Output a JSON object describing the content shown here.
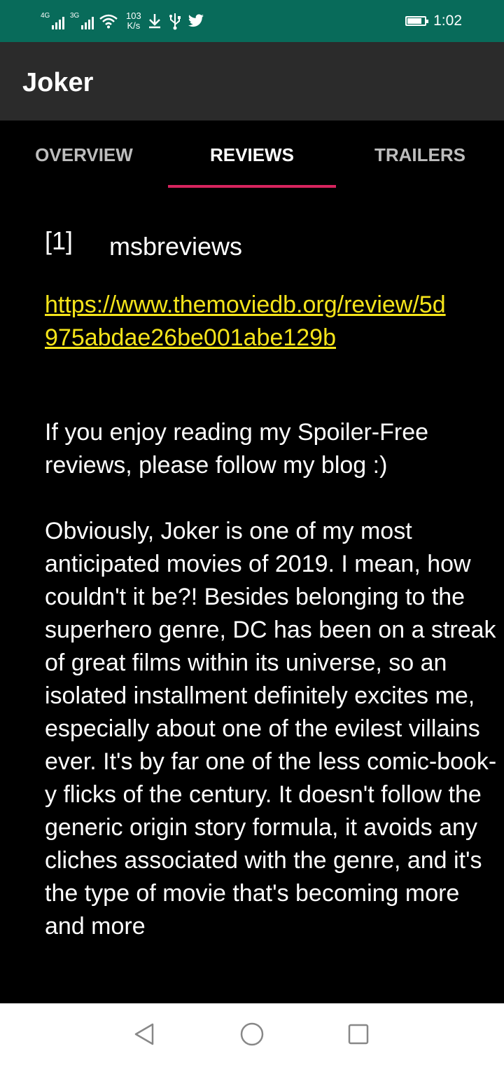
{
  "status_bar": {
    "network_type_1": "4G",
    "network_type_2": "3G",
    "speed_value": "103",
    "speed_unit": "K/s",
    "time": "1:02",
    "icons": [
      "signal-icon",
      "signal-icon",
      "wifi-icon",
      "download-icon",
      "usb-icon",
      "twitter-icon",
      "battery-icon"
    ],
    "battery_level": 0.85
  },
  "app_bar": {
    "title": "Joker"
  },
  "tabs": [
    {
      "label": "OVERVIEW",
      "active": false
    },
    {
      "label": "REVIEWS",
      "active": true
    },
    {
      "label": "TRAILERS",
      "active": false
    }
  ],
  "colors": {
    "status_bar": "#086b5a",
    "app_bar": "#2b2b2b",
    "tab_indicator": "#d6245e",
    "link": "#f5e41a",
    "background": "#000000"
  },
  "review": {
    "index": "[1]",
    "author": "msbreviews",
    "url": "https://www.themoviedb.org/review/5d975abdae26be001abe129b",
    "content": "If you enjoy reading my Spoiler-Free reviews, please follow my blog :)\n\nObviously, Joker is one of my most anticipated movies of 2019. I mean, how couldn't it be?! Besides belonging to the superhero genre, DC has been on a streak of great films within its universe, so an isolated installment definitely excites me, especially about one of the evilest villains ever. It's by far one of the less comic-book-y flicks of the century. It doesn't follow the generic origin story formula, it avoids any cliches associated with the genre, and it's the type of movie that's becoming more and more"
  },
  "nav_bar": {
    "icons": [
      "back-icon",
      "home-icon",
      "recents-icon"
    ]
  }
}
